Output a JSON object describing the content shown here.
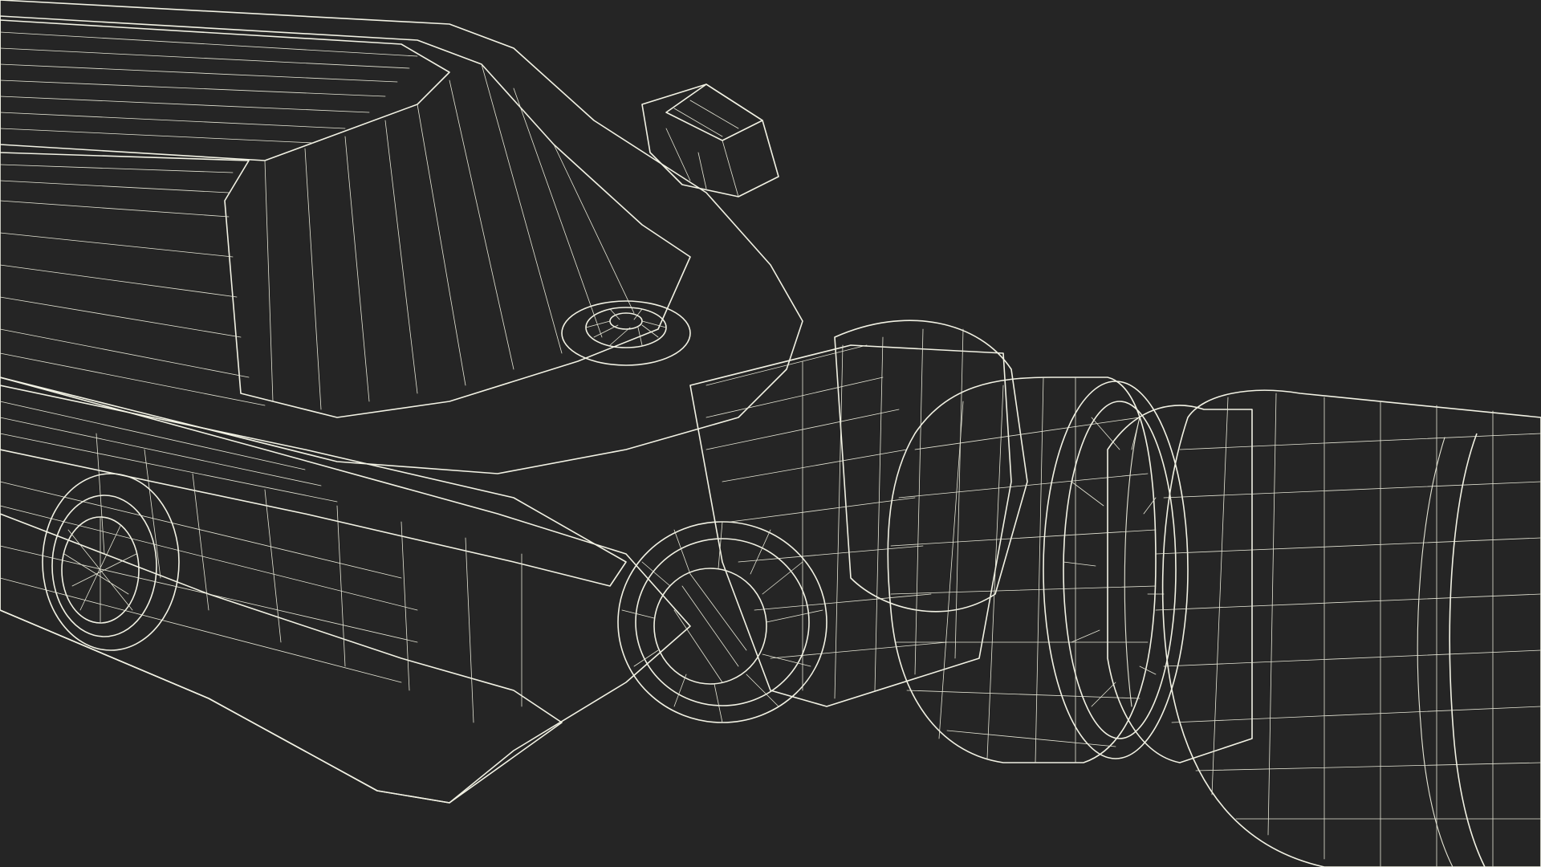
{
  "scene": {
    "subject": "",
    "colors": {
      "background": "#252525",
      "surface": "#7b7c70",
      "surface_light": "#8a8b7e",
      "surface_dark": "#5e5f55",
      "shadow": "#45463f",
      "wire": "#e6e6d6"
    }
  }
}
